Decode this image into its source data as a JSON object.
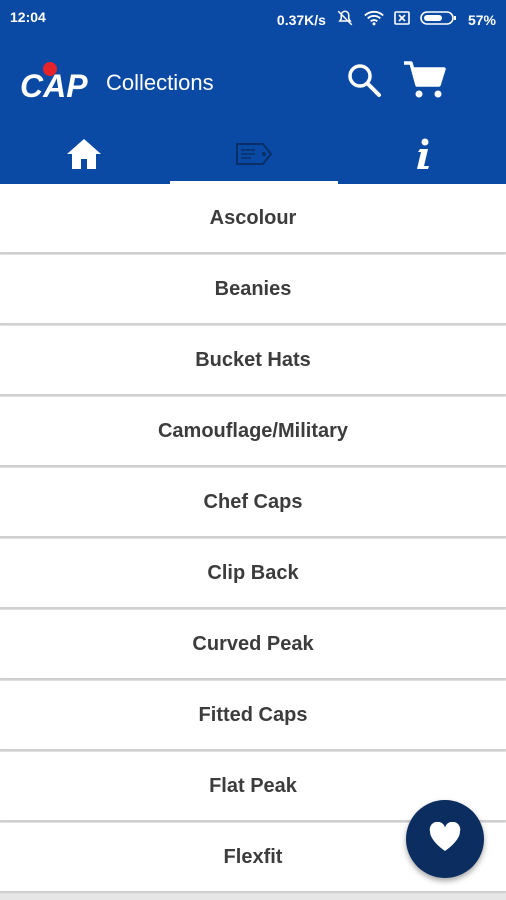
{
  "status_bar": {
    "time": "12:04",
    "network_speed": "0.37K/s",
    "battery_percent": "57%",
    "icons": [
      "mute-icon",
      "wifi-icon",
      "sim-icon",
      "battery-icon"
    ]
  },
  "app_bar": {
    "logo_text": "CAP",
    "title": "Collections",
    "actions": [
      "search-icon",
      "cart-icon"
    ],
    "colors": {
      "primary": "#0a4aa4",
      "accent_red": "#e4232b",
      "fab": "#0c2d5f"
    }
  },
  "tabs": [
    {
      "icon": "home-icon",
      "selected": false
    },
    {
      "icon": "tag-icon",
      "selected": true
    },
    {
      "icon": "info-icon",
      "selected": false
    }
  ],
  "collections": [
    "Ascolour",
    "Beanies",
    "Bucket Hats",
    "Camouflage/Military",
    "Chef Caps",
    "Clip Back",
    "Curved Peak",
    "Fitted Caps",
    "Flat Peak",
    "Flexfit"
  ],
  "fab": {
    "icon": "heart-icon"
  }
}
